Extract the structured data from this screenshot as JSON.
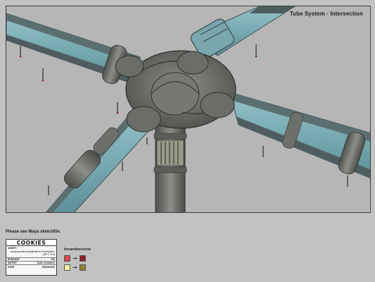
{
  "header": {
    "view_title": "Tube System · Intersection"
  },
  "note": "Please see Maya sketchfile.",
  "slate": {
    "logo": "COOKIES",
    "asset_label": "ASSET:",
    "asset_value": "kaminohanaiLandingPlatformTubeSystem (10P 1 of 4)",
    "episode_label": "EPISODE:",
    "episode_value": "715",
    "artist_label": "ARTIST",
    "artist_value": "Colin Grunther",
    "date_label": "DATE",
    "date_value": "05/29/2020"
  },
  "incandescents": {
    "title": "Incandescents",
    "rows": [
      {
        "from_color": "#d4484e",
        "to_color": "#8e2027"
      },
      {
        "from_color": "#f5ef9e",
        "to_color": "#8a8030"
      }
    ]
  },
  "colors": {
    "glass": "#7fb0b8",
    "stone": "#6e716c",
    "background": "#b6b6b6"
  }
}
